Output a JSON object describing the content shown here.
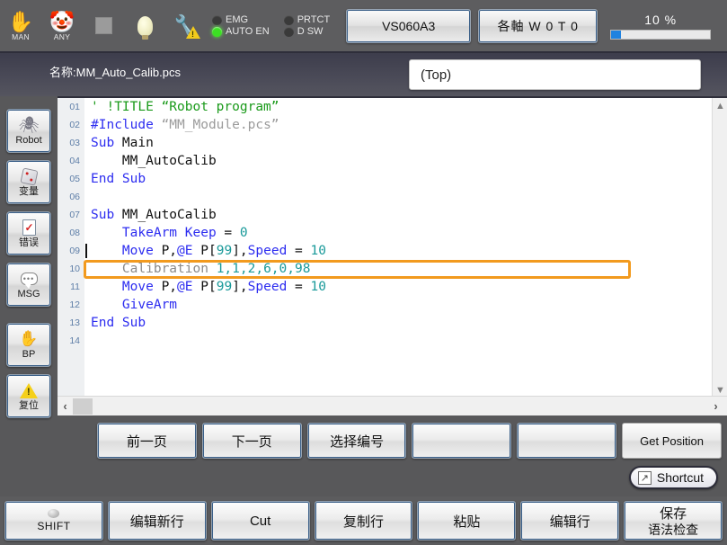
{
  "toolbar": {
    "icons": [
      {
        "name": "hand-icon",
        "glyph": "✋",
        "caption": "MAN"
      },
      {
        "name": "clown-icon",
        "glyph": "🤡",
        "caption": "ANY"
      },
      {
        "name": "stop-square-icon",
        "glyph": "",
        "caption": ""
      },
      {
        "name": "lightbulb-icon",
        "glyph": "",
        "caption": ""
      },
      {
        "name": "wrench-warning-icon",
        "glyph": "🔧",
        "caption": ""
      }
    ],
    "leds": [
      {
        "label": "EMG",
        "on": false
      },
      {
        "label": "PRTCT",
        "on": false
      },
      {
        "label": "AUTO EN",
        "on": true
      },
      {
        "label": "D SW",
        "on": false
      }
    ],
    "model_button": "VS060A3",
    "axis_button": "各軸 W 0 T 0",
    "speed_label": "10 %",
    "speed_percent": 10,
    "accent_color": "#1f82e0"
  },
  "namebar": {
    "file_label": "名称:MM_Auto_Calib.pcs",
    "scope_select": "(Top)"
  },
  "sidebar": {
    "items": [
      {
        "name": "robot",
        "icon": "robot-icon",
        "label": "Robot"
      },
      {
        "name": "variables",
        "icon": "dice-icon",
        "label": "变量"
      },
      {
        "name": "errors",
        "icon": "document-check-icon",
        "label": "错误"
      },
      {
        "name": "msg",
        "icon": "speech-bubble-icon",
        "label": "MSG"
      },
      {
        "name": "bp",
        "icon": "hand-icon",
        "label": "BP"
      },
      {
        "name": "reset",
        "icon": "warning-triangle-icon",
        "label": "复位"
      }
    ]
  },
  "editor": {
    "highlight_color": "#f29a1e",
    "highlighted_line": 10,
    "caret_line": 9,
    "lines": [
      {
        "no": "01",
        "tokens": [
          {
            "t": "' !TITLE “Robot program”",
            "c": "tk-com"
          }
        ]
      },
      {
        "no": "02",
        "tokens": [
          {
            "t": "#Include ",
            "c": "tk-kw"
          },
          {
            "t": "“MM_Module.pcs”",
            "c": "tk-str"
          }
        ]
      },
      {
        "no": "03",
        "tokens": [
          {
            "t": "Sub ",
            "c": "tk-kw"
          },
          {
            "t": "Main",
            "c": "tk-pln"
          }
        ]
      },
      {
        "no": "04",
        "tokens": [
          {
            "t": "    MM_AutoCalib",
            "c": "tk-pln"
          }
        ]
      },
      {
        "no": "05",
        "tokens": [
          {
            "t": "End Sub",
            "c": "tk-kw"
          }
        ]
      },
      {
        "no": "06",
        "tokens": [
          {
            "t": "",
            "c": "tk-pln"
          }
        ]
      },
      {
        "no": "07",
        "tokens": [
          {
            "t": "Sub ",
            "c": "tk-kw"
          },
          {
            "t": "MM_AutoCalib",
            "c": "tk-pln"
          }
        ]
      },
      {
        "no": "08",
        "tokens": [
          {
            "t": "    ",
            "c": "tk-pln"
          },
          {
            "t": "TakeArm Keep",
            "c": "tk-kw"
          },
          {
            "t": " = ",
            "c": "tk-pln"
          },
          {
            "t": "0",
            "c": "tk-num"
          }
        ]
      },
      {
        "no": "09",
        "tokens": [
          {
            "t": "    ",
            "c": "tk-pln"
          },
          {
            "t": "Move",
            "c": "tk-kw"
          },
          {
            "t": " P,",
            "c": "tk-pln"
          },
          {
            "t": "@E",
            "c": "tk-kw"
          },
          {
            "t": " P[",
            "c": "tk-pln"
          },
          {
            "t": "99",
            "c": "tk-num"
          },
          {
            "t": "],",
            "c": "tk-pln"
          },
          {
            "t": "Speed",
            "c": "tk-kw"
          },
          {
            "t": " = ",
            "c": "tk-pln"
          },
          {
            "t": "10",
            "c": "tk-num"
          }
        ]
      },
      {
        "no": "10",
        "tokens": [
          {
            "t": "    ",
            "c": "tk-pln"
          },
          {
            "t": "Calibration ",
            "c": "tk-gry"
          },
          {
            "t": "1,1,2,6,0,98",
            "c": "tk-num"
          }
        ]
      },
      {
        "no": "11",
        "tokens": [
          {
            "t": "    ",
            "c": "tk-pln"
          },
          {
            "t": "Move",
            "c": "tk-kw"
          },
          {
            "t": " P,",
            "c": "tk-pln"
          },
          {
            "t": "@E",
            "c": "tk-kw"
          },
          {
            "t": " P[",
            "c": "tk-pln"
          },
          {
            "t": "99",
            "c": "tk-num"
          },
          {
            "t": "],",
            "c": "tk-pln"
          },
          {
            "t": "Speed",
            "c": "tk-kw"
          },
          {
            "t": " = ",
            "c": "tk-pln"
          },
          {
            "t": "10",
            "c": "tk-num"
          }
        ]
      },
      {
        "no": "12",
        "tokens": [
          {
            "t": "    ",
            "c": "tk-pln"
          },
          {
            "t": "GiveArm",
            "c": "tk-kw"
          }
        ]
      },
      {
        "no": "13",
        "tokens": [
          {
            "t": "End Sub",
            "c": "tk-kw"
          }
        ]
      },
      {
        "no": "14",
        "tokens": [
          {
            "t": "",
            "c": "tk-pln"
          }
        ]
      }
    ]
  },
  "function_row": [
    {
      "name": "prev-page",
      "label": "前一页",
      "plain": false
    },
    {
      "name": "next-page",
      "label": "下一页",
      "plain": false
    },
    {
      "name": "select-number",
      "label": "选择编号",
      "plain": false
    },
    {
      "name": "fn-empty-1",
      "label": "",
      "plain": false
    },
    {
      "name": "fn-empty-2",
      "label": "",
      "plain": false
    },
    {
      "name": "get-position",
      "label": "Get Position",
      "plain": true
    }
  ],
  "shortcut": {
    "label": "Shortcut",
    "icon": "arrow-box-icon",
    "glyph": "↗"
  },
  "bottom_row": [
    {
      "name": "shift",
      "label": "SHIFT",
      "sub": "",
      "dot": true
    },
    {
      "name": "edit-new-line",
      "label": "编辑新行",
      "sub": "",
      "dot": false
    },
    {
      "name": "cut",
      "label": "Cut",
      "sub": "",
      "dot": false
    },
    {
      "name": "copy-line",
      "label": "复制行",
      "sub": "",
      "dot": false
    },
    {
      "name": "paste",
      "label": "粘贴",
      "sub": "",
      "dot": false
    },
    {
      "name": "edit-line",
      "label": "编辑行",
      "sub": "",
      "dot": false
    },
    {
      "name": "save-syntax-check",
      "label": "保存",
      "sub": "语法检查",
      "dot": false
    }
  ]
}
